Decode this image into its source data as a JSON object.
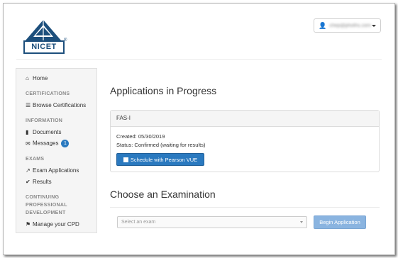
{
  "header": {
    "logo_text": "NICET",
    "logo_reg": "®",
    "user_email": "chep@phoths.com"
  },
  "sidebar": {
    "home": "Home",
    "certifications_heading": "CERTIFICATIONS",
    "browse_certifications": "Browse Certifications",
    "information_heading": "INFORMATION",
    "documents": "Documents",
    "messages": "Messages",
    "messages_count": "1",
    "exams_heading": "EXAMS",
    "exam_applications": "Exam Applications",
    "results": "Results",
    "cpd_heading_1": "CONTINUING",
    "cpd_heading_2": "PROFESSIONAL",
    "cpd_heading_3": "DEVELOPMENT",
    "manage_cpd": "Manage your CPD"
  },
  "main": {
    "applications_title": "Applications in Progress",
    "application": {
      "name": "FAS-I",
      "created": "Created: 05/30/2019",
      "status": "Status: Confirmed (waiting for results)",
      "schedule_label": "Schedule with Pearson VUE"
    },
    "choose_title": "Choose an Examination",
    "exam_select_placeholder": "Select an exam",
    "begin_label": "Begin Application"
  },
  "colors": {
    "brand_navy": "#1d4f7c",
    "primary_blue": "#2a79bf",
    "disabled_blue": "#8ab4e0"
  }
}
